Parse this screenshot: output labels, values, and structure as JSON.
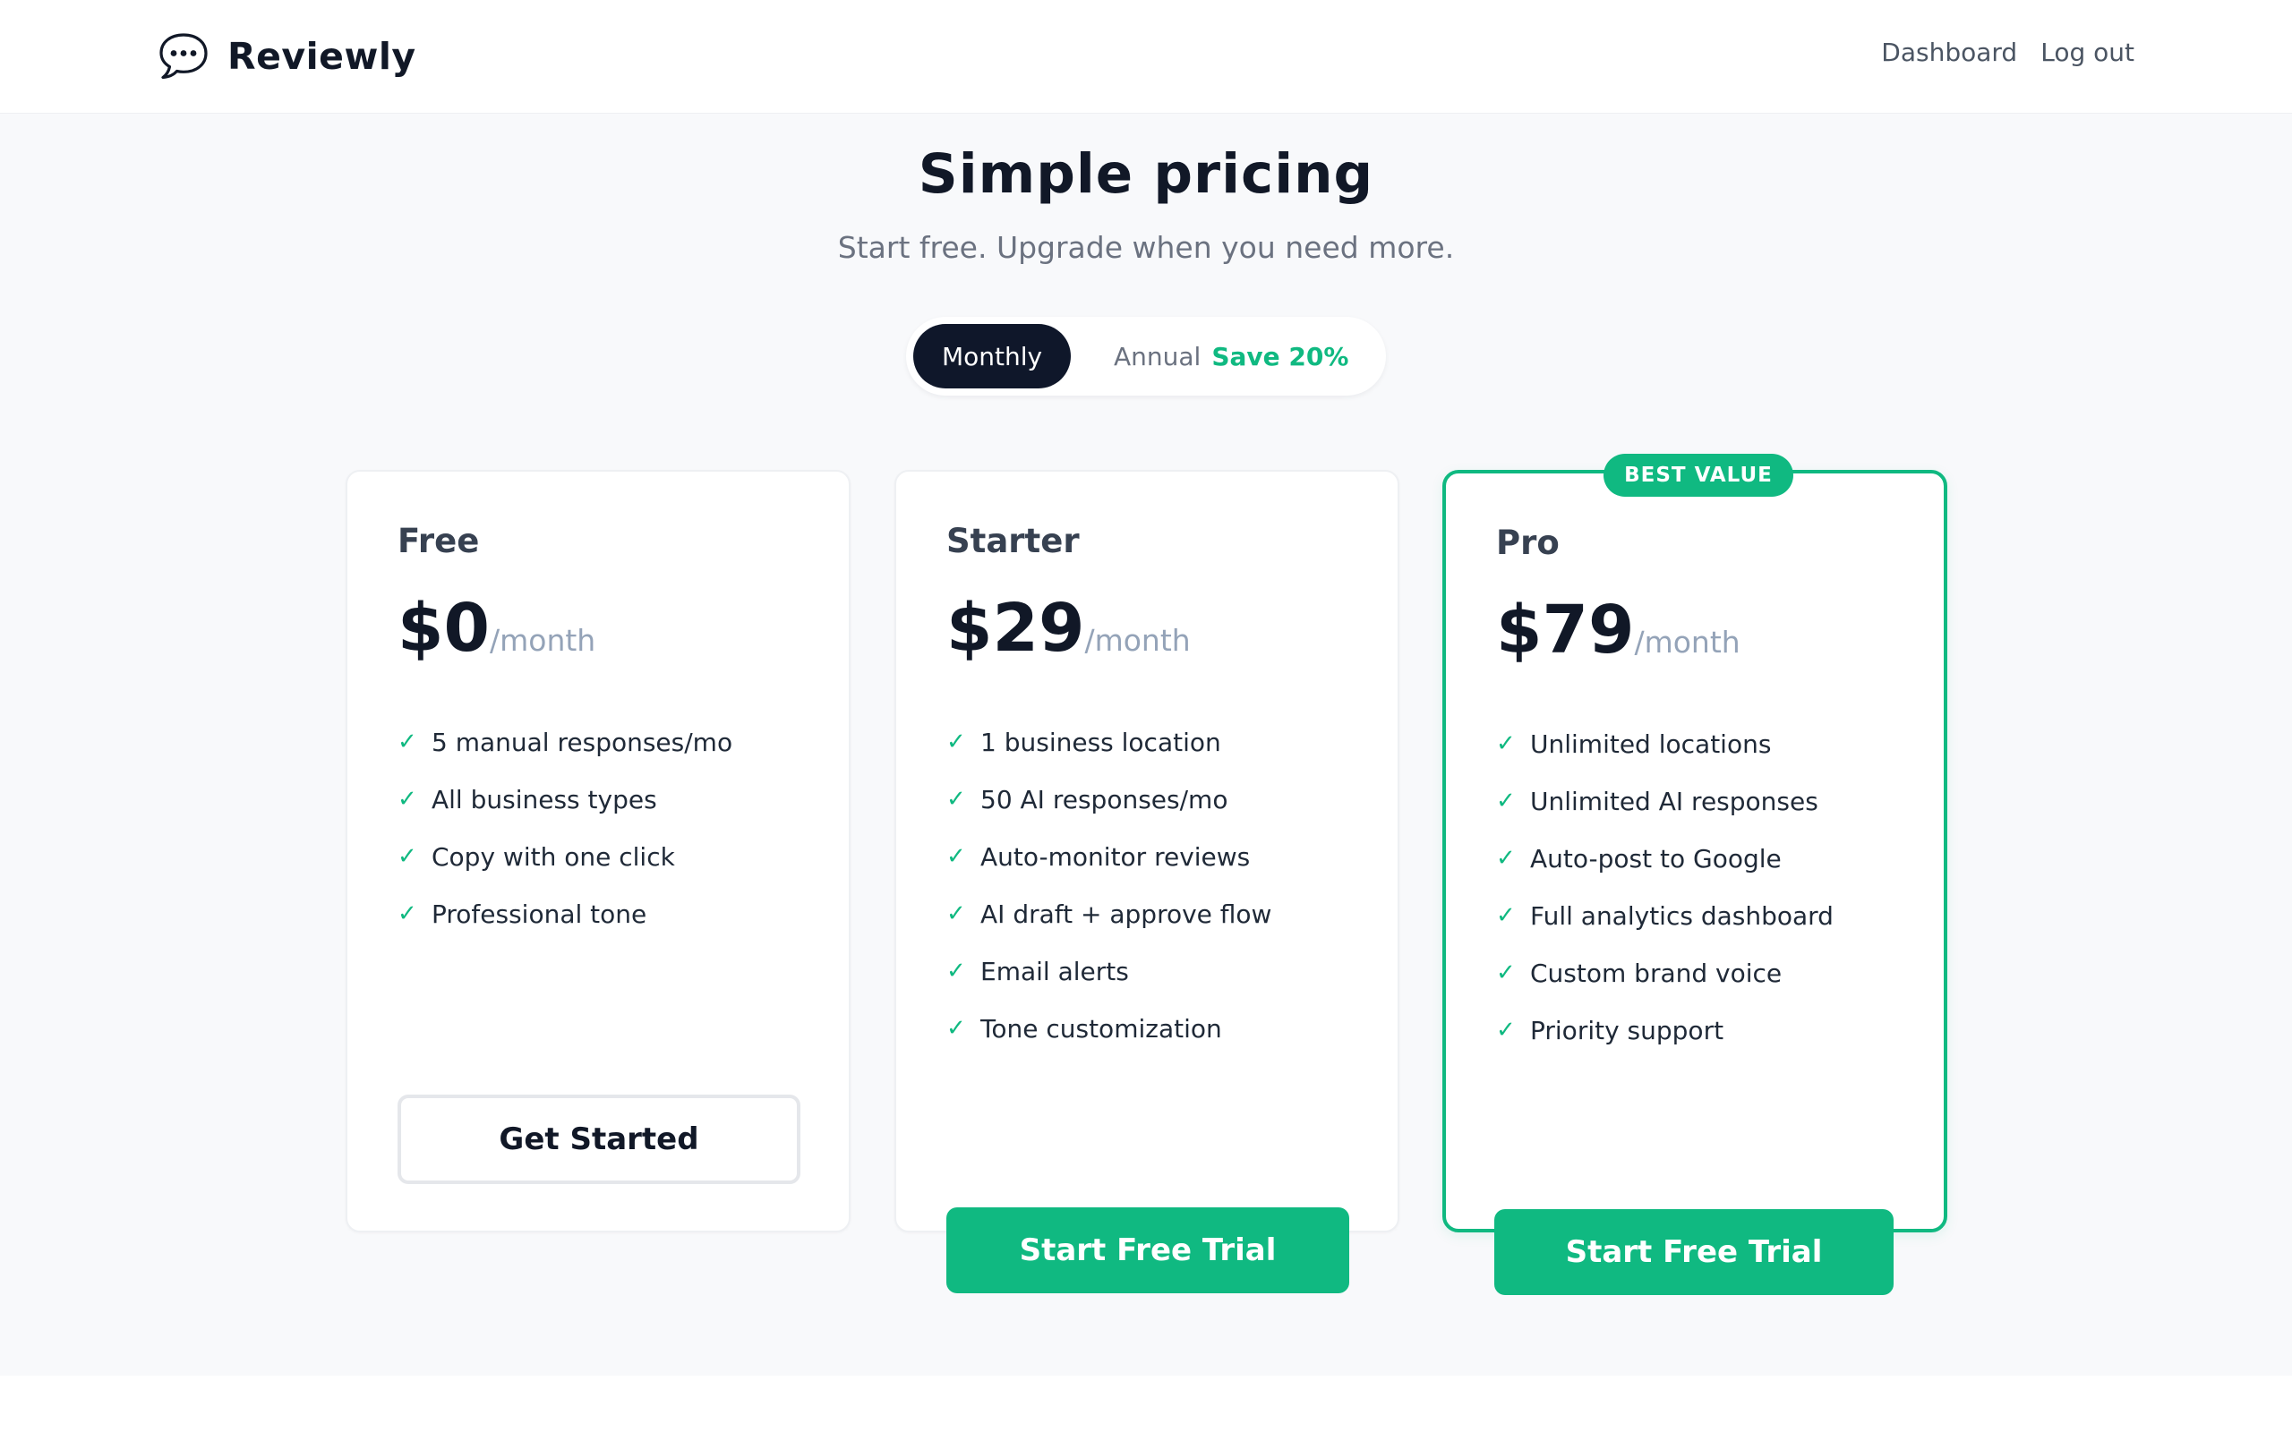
{
  "app": {
    "brand_name": "Reviewly",
    "brand_icon": "speech-bubble-icon"
  },
  "nav": {
    "dashboard": "Dashboard",
    "logout": "Log out"
  },
  "hero": {
    "title": "Simple pricing",
    "subtitle": "Start free. Upgrade when you need more."
  },
  "billing_toggle": {
    "monthly": "Monthly",
    "annual": "Annual",
    "annual_savings": "Save 20%",
    "selected": "Monthly"
  },
  "plans": [
    {
      "name": "Free",
      "price": "$0",
      "period": "/month",
      "features": [
        "5 manual responses/mo",
        "All business types",
        "Copy with one click",
        "Professional tone"
      ],
      "cta": "Get Started"
    },
    {
      "name": "Starter",
      "price": "$29",
      "period": "/month",
      "features": [
        "1 business location",
        "50 AI responses/mo",
        "Auto-monitor reviews",
        "AI draft + approve flow",
        "Email alerts",
        "Tone customization"
      ],
      "cta": "Start Free Trial"
    },
    {
      "name": "Pro",
      "badge": "BEST VALUE",
      "price": "$79",
      "period": "/month",
      "features": [
        "Unlimited locations",
        "Unlimited AI responses",
        "Auto-post to Google",
        "Full analytics dashboard",
        "Custom brand voice",
        "Priority support"
      ],
      "cta": "Start Free Trial"
    }
  ],
  "colors": {
    "accent": "#10b981",
    "dark": "#0f172a",
    "text_muted": "#6b7280",
    "background": "#f8f9fb"
  },
  "icons": {
    "check": "check-icon"
  }
}
